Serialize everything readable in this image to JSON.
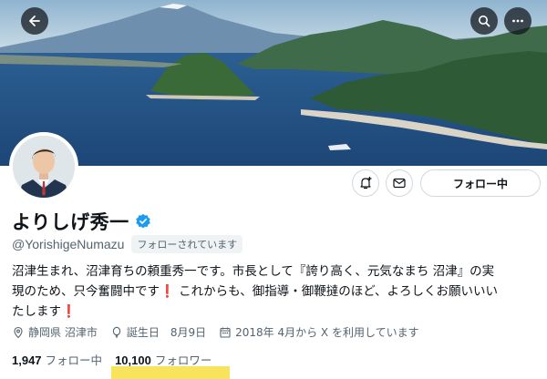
{
  "header": {
    "back_icon": "arrow-left-icon",
    "search_icon": "search-icon",
    "more_icon": "more-horizontal-icon"
  },
  "profile": {
    "display_name": "よりしげ秀一",
    "handle": "@YorishigeNumazu",
    "follows_you_badge": "フォローされています",
    "verified": true,
    "bio_line1": "沼津生まれ、沼津育ちの頼重秀一です。市長として『誇り高く、元気なまち 沼津』の実",
    "bio_line2a": "現のため、只今奮闘中です",
    "bio_mark": "❗",
    "bio_line2b": " これからも、御指導・御鞭撻のほど、よろしくお願いいい",
    "bio_line3": "たします",
    "location": "静岡県 沼津市",
    "birthday_label": "誕生日",
    "birthday_value": "8月9日",
    "joined": "2018年 4月から X を利用しています"
  },
  "actions": {
    "notify_icon": "bell-plus-icon",
    "message_icon": "mail-icon",
    "follow_label": "フォロー中"
  },
  "stats": {
    "following_count": "1,947",
    "following_label": "フォロー中",
    "followers_count": "10,100",
    "followers_label": "フォロワー"
  },
  "colors": {
    "verified": "#1d9bf0",
    "secondary_text": "#536471",
    "highlight": "#f8e45c",
    "exclamation": "#e0245e"
  }
}
